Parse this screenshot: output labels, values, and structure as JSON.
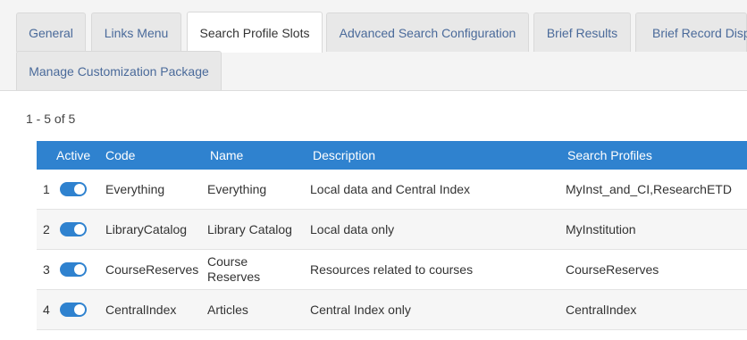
{
  "tabs": [
    {
      "label": "General",
      "active": false
    },
    {
      "label": "Links Menu",
      "active": false
    },
    {
      "label": "Search Profile Slots",
      "active": true
    },
    {
      "label": "Advanced Search Configuration",
      "active": false
    },
    {
      "label": "Brief Results",
      "active": false
    },
    {
      "label": "Brief Record Displ",
      "active": false
    },
    {
      "label": "Manage Customization Package",
      "active": false
    }
  ],
  "pagination": {
    "text": "1 - 5 of 5"
  },
  "table": {
    "headers": {
      "active": "Active",
      "code": "Code",
      "name": "Name",
      "description": "Description",
      "profiles": "Search Profiles"
    },
    "rows": [
      {
        "num": "1",
        "active": true,
        "code": "Everything",
        "name": "Everything",
        "description": "Local data and Central Index",
        "profiles": "MyInst_and_CI,ResearchETD"
      },
      {
        "num": "2",
        "active": true,
        "code": "LibraryCatalog",
        "name": "Library Catalog",
        "description": "Local data only",
        "profiles": "MyInstitution"
      },
      {
        "num": "3",
        "active": true,
        "code": "CourseReserves",
        "name": "Course Reserves",
        "description": "Resources related to courses",
        "profiles": "CourseReserves"
      },
      {
        "num": "4",
        "active": true,
        "code": "CentralIndex",
        "name": "Articles",
        "description": "Central Index only",
        "profiles": "CentralIndex"
      }
    ]
  },
  "colors": {
    "accent": "#2f82cf",
    "tab_text": "#4a6a9a"
  }
}
